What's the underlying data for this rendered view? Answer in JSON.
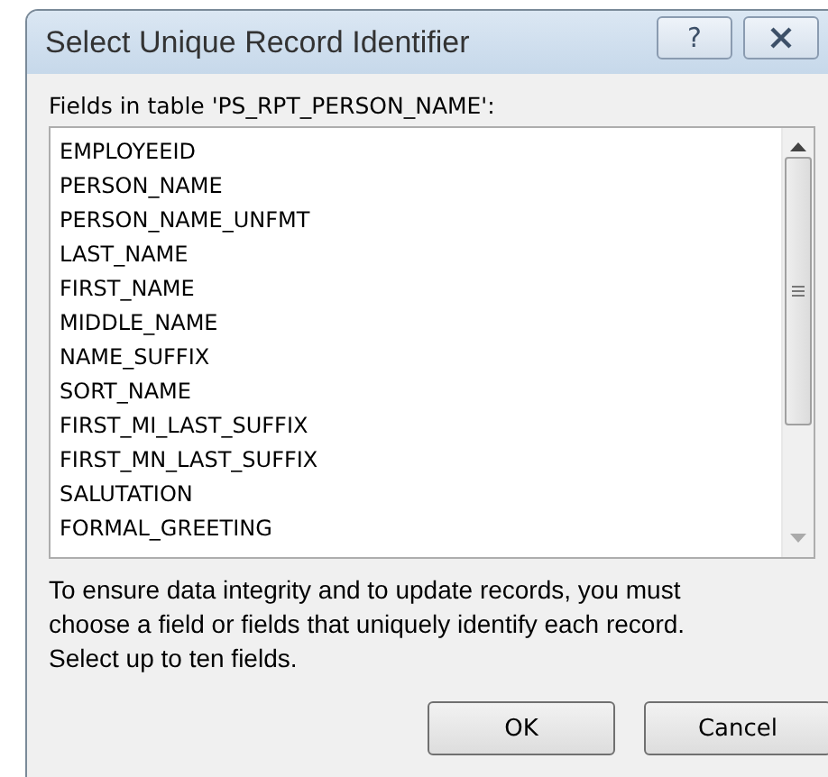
{
  "window": {
    "title": "Select Unique Record Identifier",
    "help_button": "?"
  },
  "fields_label": "Fields in table 'PS_RPT_PERSON_NAME':",
  "fields": [
    {
      "label": "EMPLOYEEID",
      "selected": false
    },
    {
      "label": "PERSON_NAME",
      "selected": false
    },
    {
      "label": "PERSON_NAME_UNFMT",
      "selected": false
    },
    {
      "label": "LAST_NAME",
      "selected": false
    },
    {
      "label": "FIRST_NAME",
      "selected": false
    },
    {
      "label": "MIDDLE_NAME",
      "selected": false
    },
    {
      "label": "NAME_SUFFIX",
      "selected": false
    },
    {
      "label": "SORT_NAME",
      "selected": false
    },
    {
      "label": "FIRST_MI_LAST_SUFFIX",
      "selected": false
    },
    {
      "label": "FIRST_MN_LAST_SUFFIX",
      "selected": false
    },
    {
      "label": "SALUTATION",
      "selected": false
    },
    {
      "label": "FORMAL_GREETING",
      "selected": false
    }
  ],
  "description": "To ensure data integrity and to update records, you must choose a field or fields that uniquely identify each record. Select up to ten fields.",
  "buttons": [
    "OK",
    "Cancel"
  ]
}
